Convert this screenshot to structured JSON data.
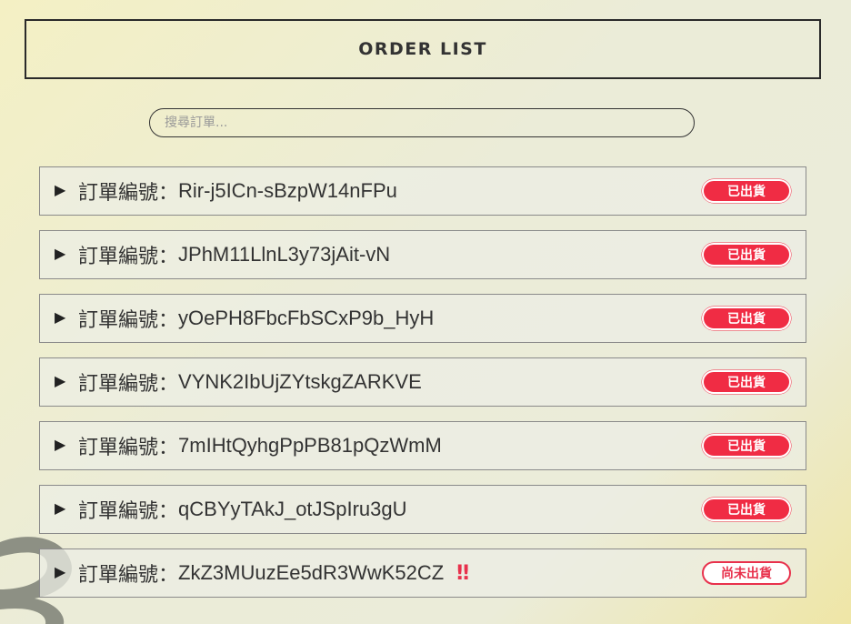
{
  "header": {
    "title": "ORDER LIST"
  },
  "search": {
    "placeholder": "搜尋訂單..."
  },
  "order_label": "訂單編號：",
  "colors": {
    "shipped_badge": "#f02c44",
    "pending_badge_border": "#e8314c"
  },
  "orders": [
    {
      "id": "Rir-j5ICn-sBzpW14nFPu",
      "status": "已出貨",
      "status_type": "shipped",
      "alert": ""
    },
    {
      "id": "JPhM11LlnL3y73jAit-vN",
      "status": "已出貨",
      "status_type": "shipped",
      "alert": ""
    },
    {
      "id": "yOePH8FbcFbSCxP9b_HyH",
      "status": "已出貨",
      "status_type": "shipped",
      "alert": ""
    },
    {
      "id": "VYNK2IbUjZYtskgZARKVE",
      "status": "已出貨",
      "status_type": "shipped",
      "alert": ""
    },
    {
      "id": "7mIHtQyhgPpPB81pQzWmM",
      "status": "已出貨",
      "status_type": "shipped",
      "alert": ""
    },
    {
      "id": "qCBYyTAkJ_otJSpIru3gU",
      "status": "已出貨",
      "status_type": "shipped",
      "alert": ""
    },
    {
      "id": "ZkZ3MUuzEe5dR3WwK52CZ",
      "status": "尚未出貨",
      "status_type": "pending",
      "alert": "‼"
    }
  ]
}
